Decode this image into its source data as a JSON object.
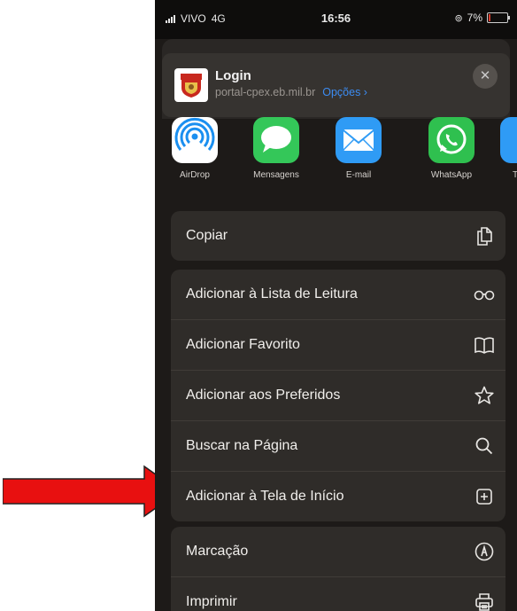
{
  "status_bar": {
    "carrier": "VIVO",
    "network": "4G",
    "time": "16:56",
    "battery": "7%",
    "battery_level": 0.07
  },
  "header": {
    "title": "Login",
    "url": "portal-cpex.eb.mil.br",
    "options_label": "Opções ›",
    "close_glyph": "✕"
  },
  "apps": [
    {
      "label": "AirDrop",
      "icon": "airdrop-icon"
    },
    {
      "label": "Mensagens",
      "icon": "messages-icon"
    },
    {
      "label": "E-mail",
      "icon": "mail-icon"
    },
    {
      "label": "WhatsApp",
      "icon": "whatsapp-icon"
    },
    {
      "label": "T",
      "icon": "partial-app-icon"
    }
  ],
  "actions": {
    "copy": {
      "label": "Copiar",
      "icon": "copy-icon"
    },
    "reading_list": {
      "label": "Adicionar à Lista de Leitura",
      "icon": "glasses-icon"
    },
    "bookmark": {
      "label": "Adicionar Favorito",
      "icon": "book-icon"
    },
    "favorites": {
      "label": "Adicionar aos Preferidos",
      "icon": "star-icon"
    },
    "find": {
      "label": "Buscar na Página",
      "icon": "search-icon"
    },
    "home_screen": {
      "label": "Adicionar à Tela de Início",
      "icon": "add-square-icon"
    },
    "markup": {
      "label": "Marcação",
      "icon": "markup-icon"
    },
    "print": {
      "label": "Imprimir",
      "icon": "printer-icon"
    }
  },
  "annotation": {
    "arrow_color": "#e81010"
  },
  "colors": {
    "accent": "#3c8cf2",
    "sheet": "#1d1a18",
    "cell": "#2f2c29"
  }
}
